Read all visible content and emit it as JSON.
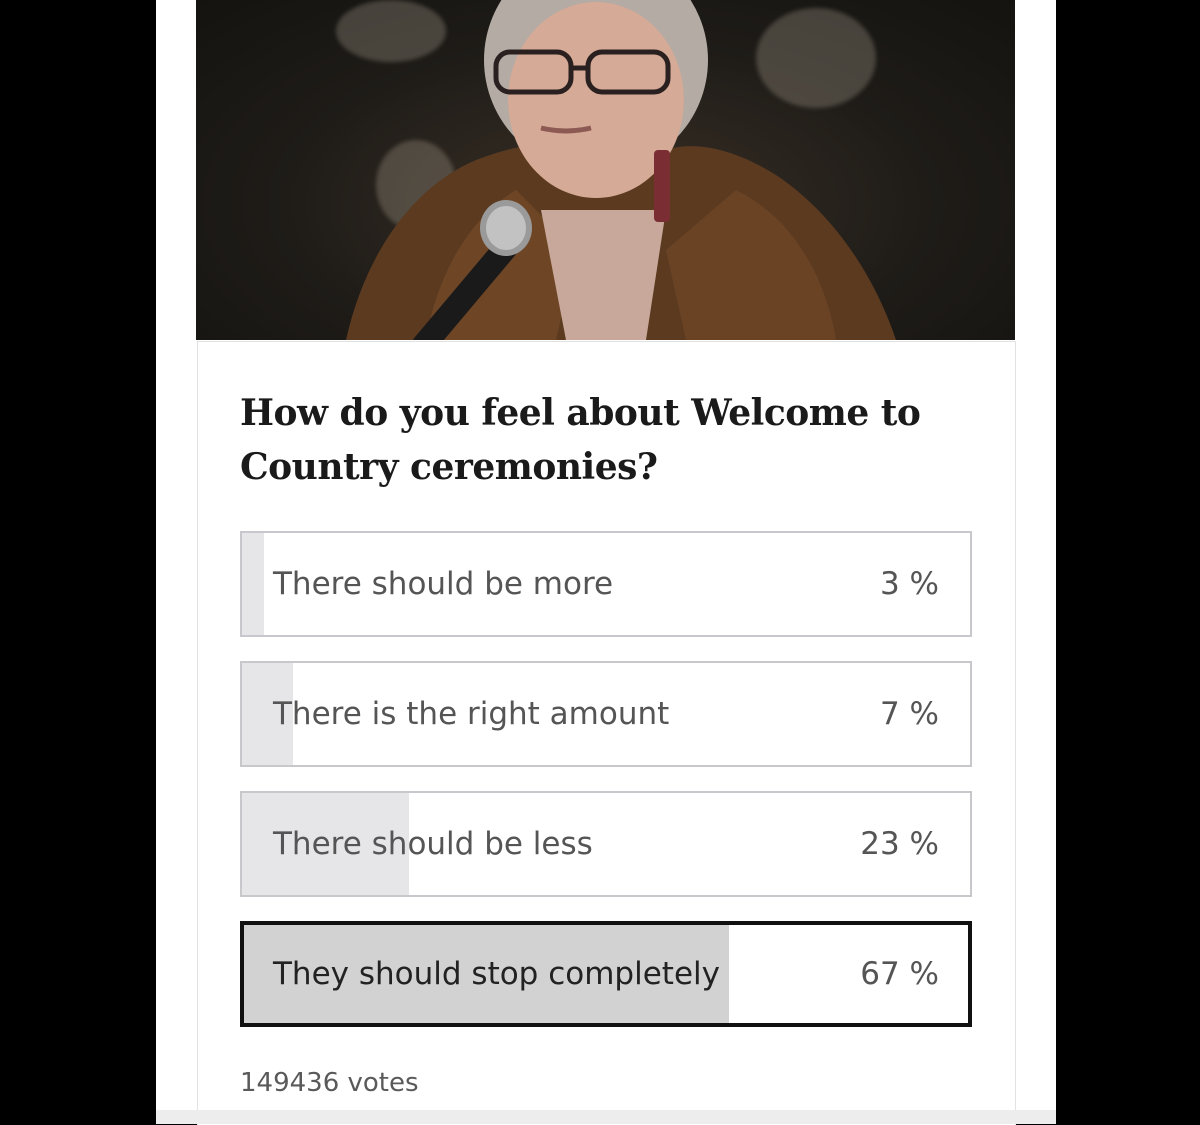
{
  "poll": {
    "question": "How do you feel about Welcome to Country ceremonies?",
    "options": [
      {
        "label": "There should be more",
        "percent_text": "3 %",
        "percent": 3,
        "selected": false
      },
      {
        "label": "There is the right amount",
        "percent_text": "7 %",
        "percent": 7,
        "selected": false
      },
      {
        "label": "There should be less",
        "percent_text": "23 %",
        "percent": 23,
        "selected": false
      },
      {
        "label": "They should stop completely",
        "percent_text": "67 %",
        "percent": 67,
        "selected": true
      }
    ],
    "votes_text": "149436 votes"
  },
  "colors": {
    "option_border": "#c8c8cc",
    "selected_border": "#111111",
    "result_fill": "#e6e6e9",
    "selected_fill": "#d2d2d2"
  }
}
